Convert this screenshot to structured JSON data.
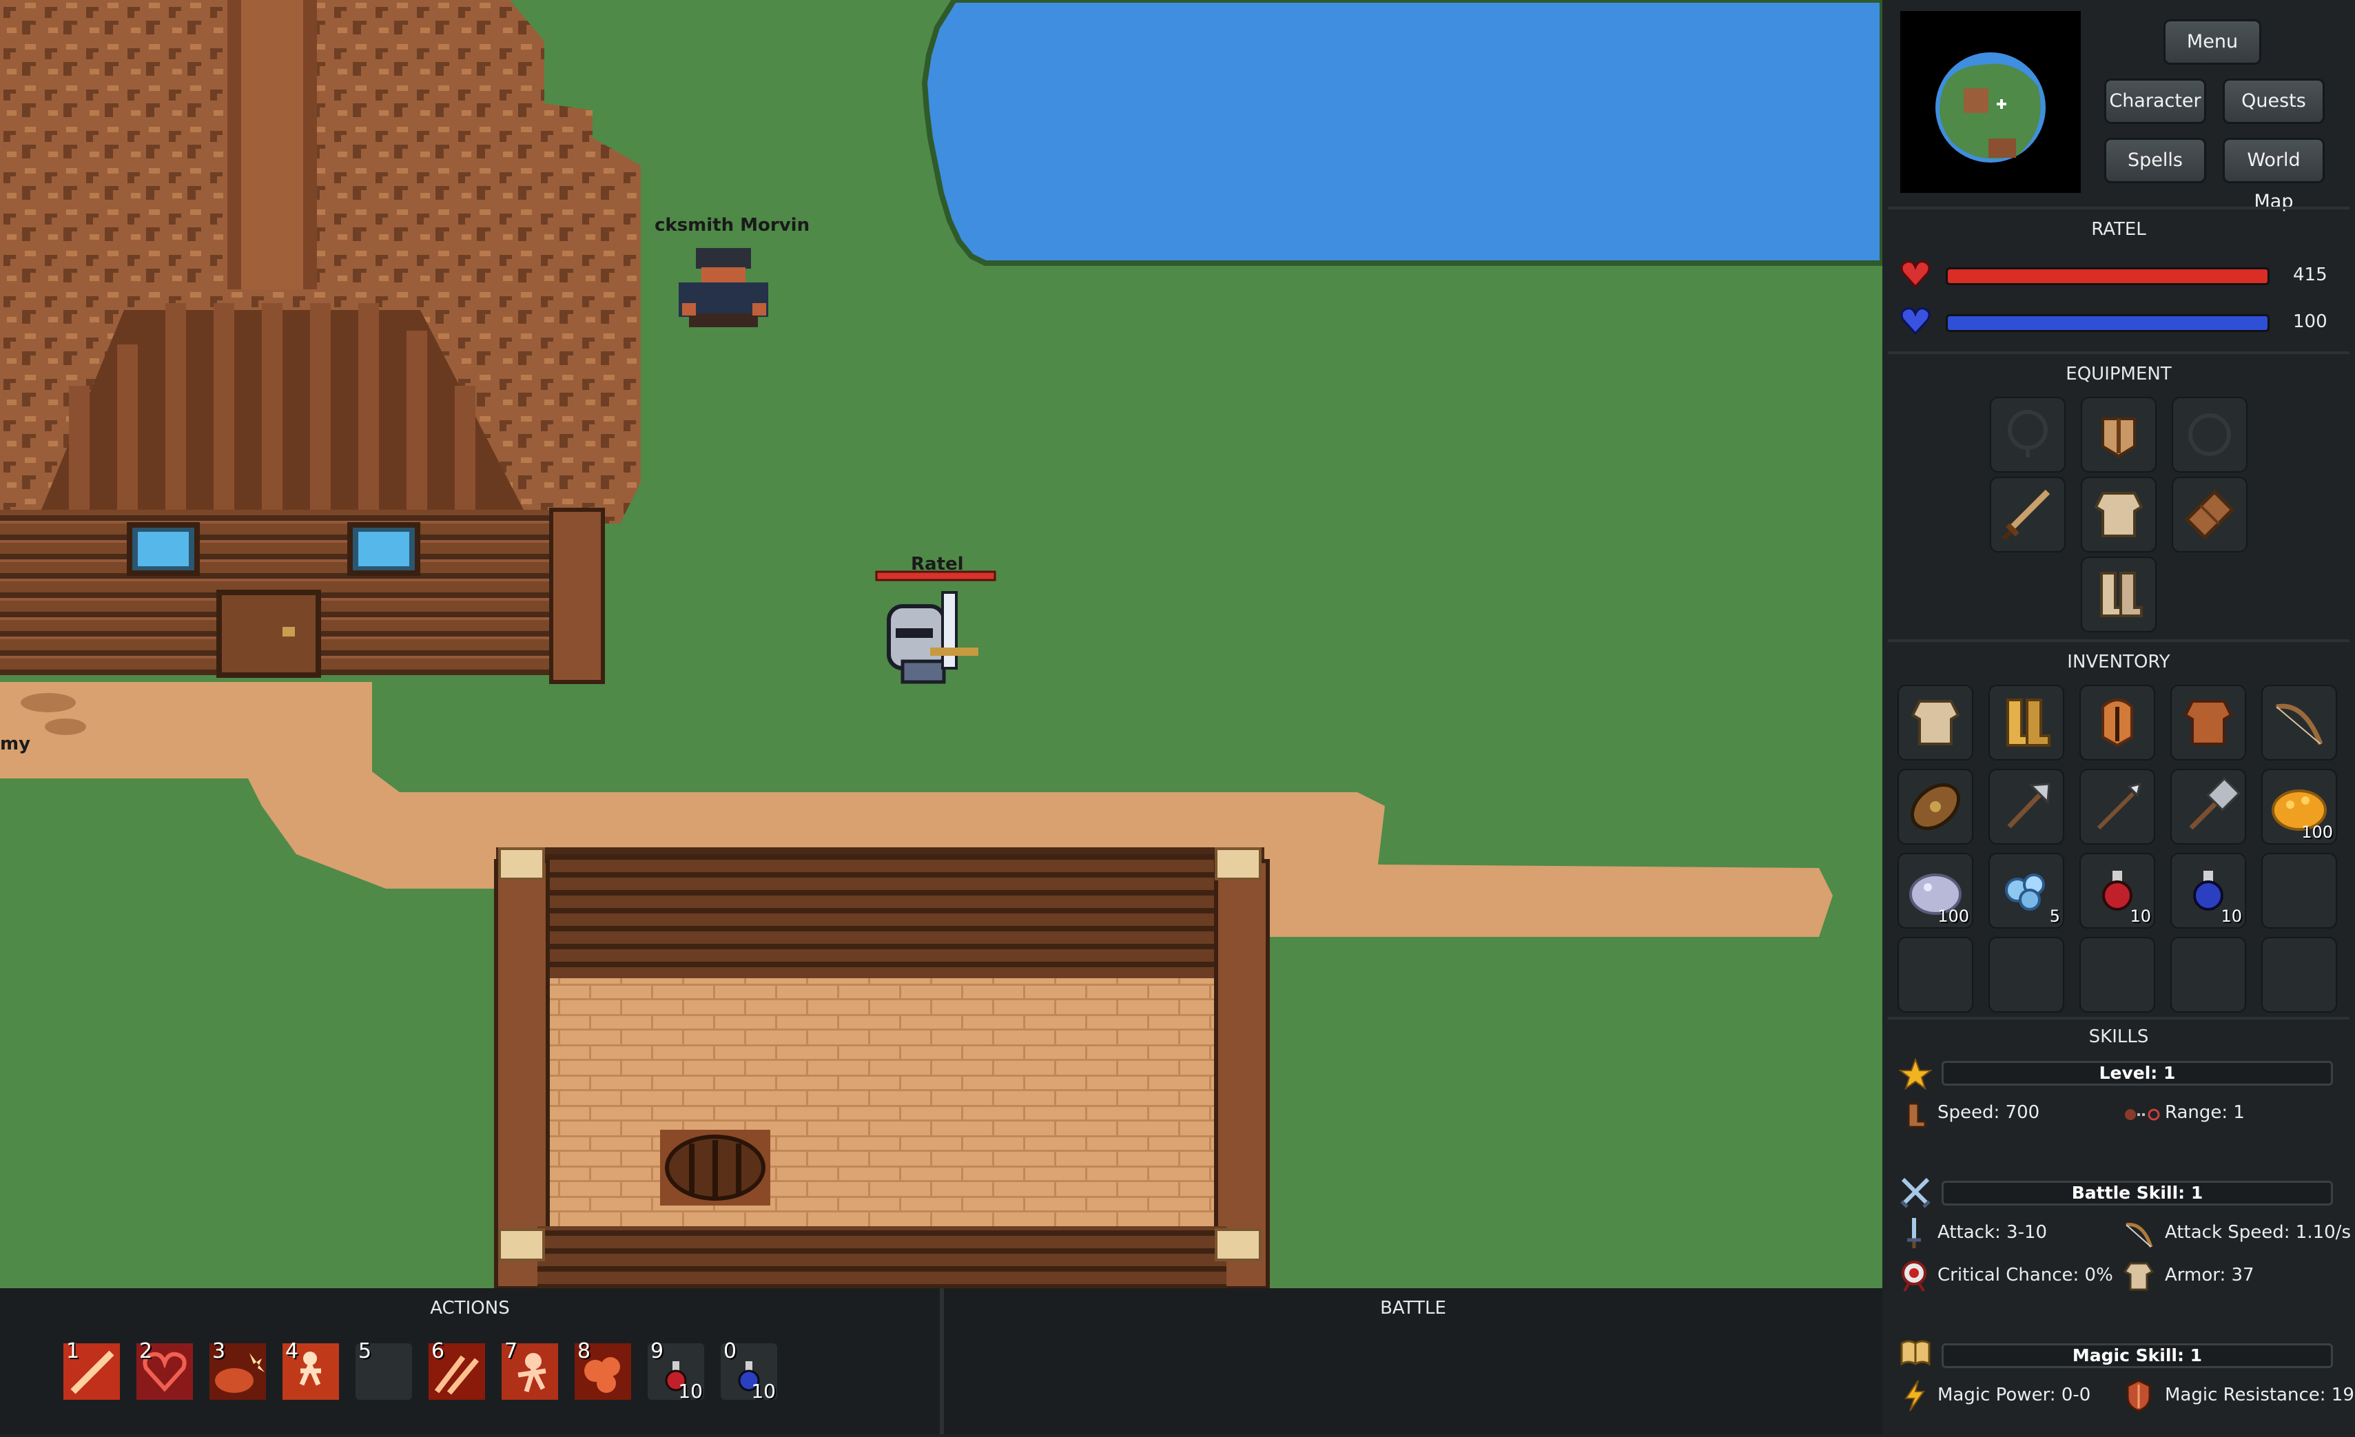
{
  "world": {
    "npc_name": "cksmith Morvin",
    "player_name": "Ratel",
    "left_edge_label": "my"
  },
  "menu_buttons": {
    "menu": "Menu",
    "character": "Character",
    "quests": "Quests",
    "spells": "Spells",
    "world_map": "World Map"
  },
  "player": {
    "name": "RATEL",
    "health": "415",
    "mana": "100",
    "health_color": "#d92d25",
    "mana_color": "#2f4fd6"
  },
  "equipment": {
    "title": "EQUIPMENT"
  },
  "inventory": {
    "title": "INVENTORY",
    "counts": {
      "gold": "100",
      "silver": "100",
      "gems": "5",
      "health_potions": "10",
      "mana_potions": "10"
    }
  },
  "skills": {
    "title": "SKILLS",
    "level": "Level: 1",
    "speed": "Speed: 700",
    "range": "Range: 1",
    "battle_skill": "Battle Skill: 1",
    "attack": "Attack: 3-10",
    "attack_speed": "Attack Speed: 1.10/s",
    "critical_chance": "Critical Chance: 0%",
    "armor": "Armor: 37",
    "magic_skill": "Magic Skill: 1",
    "magic_power": "Magic Power: 0-0",
    "magic_resistance": "Magic Resistance: 19"
  },
  "actions": {
    "title": "ACTIONS",
    "slots": [
      {
        "key": "1",
        "icon": "slash-skill-icon"
      },
      {
        "key": "2",
        "icon": "heart-skill-icon"
      },
      {
        "key": "3",
        "icon": "fire-burst-skill-icon"
      },
      {
        "key": "4",
        "icon": "warrior-leap-skill-icon"
      },
      {
        "key": "5",
        "icon": ""
      },
      {
        "key": "6",
        "icon": "double-strike-skill-icon"
      },
      {
        "key": "7",
        "icon": "rage-skill-icon"
      },
      {
        "key": "8",
        "icon": "stone-skin-skill-icon"
      },
      {
        "key": "9",
        "icon": "health-potion-icon",
        "count": "10"
      },
      {
        "key": "0",
        "icon": "mana-potion-icon",
        "count": "10"
      }
    ]
  },
  "battle": {
    "title": "BATTLE"
  }
}
